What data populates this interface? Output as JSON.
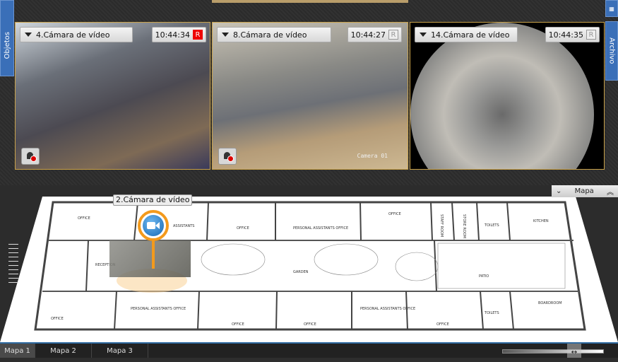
{
  "left_panel": {
    "label": "Objetos"
  },
  "right_panel": {
    "label": "Archivo",
    "icon": "grid-icon"
  },
  "cameras": [
    {
      "name": "4.Cámara de vídeo",
      "time": "10:44:34",
      "rec": "R",
      "recording": true
    },
    {
      "name": "8.Cámara de vídeo",
      "time": "10:44:27",
      "rec": "R",
      "recording": false,
      "overlay": "Camera 01"
    },
    {
      "name": "14.Cámara de vídeo",
      "time": "10:44:35",
      "rec": "R",
      "recording": false
    }
  ],
  "map": {
    "panel_label": "Mapa",
    "camera_label": "2.Cámara de vídeo",
    "rooms": [
      "OFFICE",
      "ASSISTANTS",
      "OFFICE",
      "PERSONAL ASSISTANTS OFFICE",
      "OFFICE",
      "STAFF ROOM",
      "STORE ROOM",
      "TOILETS",
      "KITCHEN",
      "RECEPTION",
      "GARDEN",
      "PATIO",
      "OFFICE",
      "PERSONAL ASSISTANTS OFFICE",
      "OFFICE",
      "OFFICE",
      "PERSONAL ASSISTANTS OFFICE",
      "OFFICE",
      "TOILETS",
      "BOARDROOM"
    ]
  },
  "map_tabs": [
    "Mapa 1",
    "Mapa 2",
    "Mapa 3"
  ],
  "colors": {
    "accent": "#3a6fb8",
    "pin": "#f39a1c",
    "record": "#e00000"
  }
}
